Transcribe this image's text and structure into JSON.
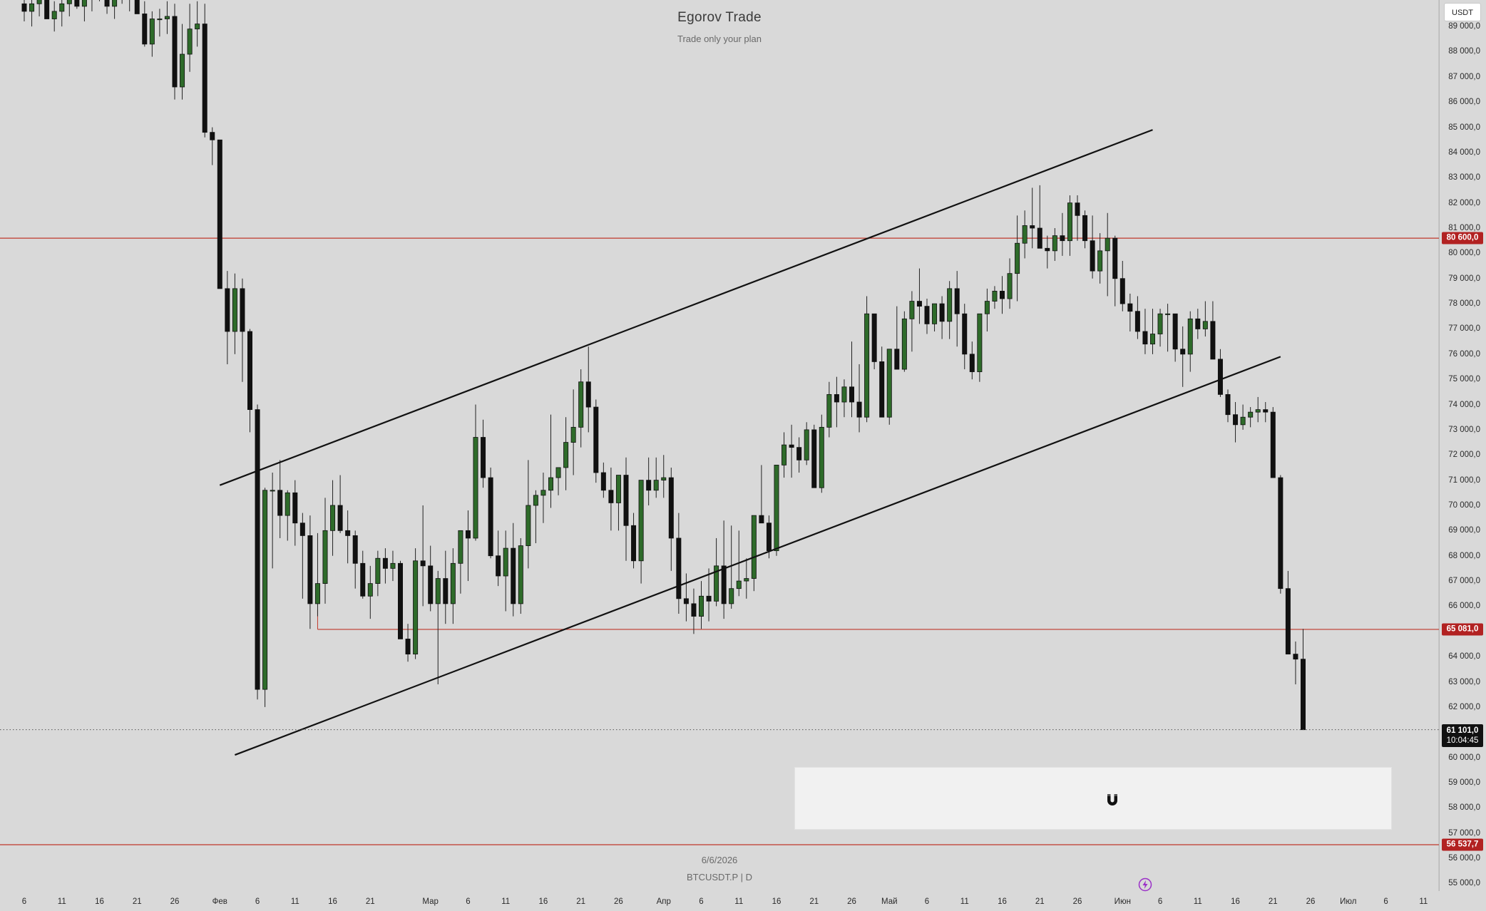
{
  "watermark": {
    "title": "Egorov Trade",
    "subtitle": "Trade only your plan"
  },
  "bottom_info": {
    "date": "6/6/2026",
    "symbol": "BTCUSDT.P | D"
  },
  "currency_button": "USDT",
  "colors": {
    "background": "#d9d9d9",
    "bull": "#2e6b2a",
    "bear": "#111111",
    "level_line": "#c0392b",
    "badge": "#b22222",
    "trendline": "#111111"
  },
  "icons": {
    "magnet": "magnet-icon",
    "replay": "lightning-icon"
  },
  "chart_data": {
    "type": "candlestick",
    "timeframe": "D",
    "ylim": [
      54700,
      90050
    ],
    "y_ticks": [
      55000,
      56000,
      57000,
      58000,
      59000,
      60000,
      61000,
      62000,
      63000,
      64000,
      65000,
      66000,
      67000,
      68000,
      69000,
      70000,
      71000,
      72000,
      73000,
      74000,
      75000,
      76000,
      77000,
      78000,
      79000,
      80000,
      81000,
      82000,
      83000,
      84000,
      85000,
      86000,
      87000,
      88000,
      89000
    ],
    "y_tick_labels": [
      "55 000,0",
      "56 000,0",
      "57 000,0",
      "58 000,0",
      "59 000,0",
      "60 000,0",
      "61 000,0",
      "62 000,0",
      "63 000,0",
      "64 000,0",
      "65 000,0",
      "66 000,0",
      "67 000,0",
      "68 000,0",
      "69 000,0",
      "70 000,0",
      "71 000,0",
      "72 000,0",
      "73 000,0",
      "74 000,0",
      "75 000,0",
      "76 000,0",
      "77 000,0",
      "78 000,0",
      "79 000,0",
      "80 000,0",
      "81 000,0",
      "82 000,0",
      "83 000,0",
      "84 000,0",
      "85 000,0",
      "86 000,0",
      "87 000,0",
      "88 000,0",
      "89 000,0"
    ],
    "x_ticks": [
      {
        "i": 0,
        "label": "6"
      },
      {
        "i": 5,
        "label": "11"
      },
      {
        "i": 10,
        "label": "16"
      },
      {
        "i": 15,
        "label": "21"
      },
      {
        "i": 20,
        "label": "26"
      },
      {
        "i": 26,
        "label": "Фев"
      },
      {
        "i": 31,
        "label": "6"
      },
      {
        "i": 36,
        "label": "11"
      },
      {
        "i": 41,
        "label": "16"
      },
      {
        "i": 46,
        "label": "21"
      },
      {
        "i": 54,
        "label": "Мар"
      },
      {
        "i": 59,
        "label": "6"
      },
      {
        "i": 64,
        "label": "11"
      },
      {
        "i": 69,
        "label": "16"
      },
      {
        "i": 74,
        "label": "21"
      },
      {
        "i": 79,
        "label": "26"
      },
      {
        "i": 85,
        "label": "Апр"
      },
      {
        "i": 90,
        "label": "6"
      },
      {
        "i": 95,
        "label": "11"
      },
      {
        "i": 100,
        "label": "16"
      },
      {
        "i": 105,
        "label": "21"
      },
      {
        "i": 110,
        "label": "26"
      },
      {
        "i": 115,
        "label": "Май"
      },
      {
        "i": 120,
        "label": "6"
      },
      {
        "i": 125,
        "label": "11"
      },
      {
        "i": 130,
        "label": "16"
      },
      {
        "i": 135,
        "label": "21"
      },
      {
        "i": 140,
        "label": "26"
      },
      {
        "i": 146,
        "label": "Июн"
      },
      {
        "i": 151,
        "label": "6"
      },
      {
        "i": 156,
        "label": "11"
      },
      {
        "i": 161,
        "label": "16"
      },
      {
        "i": 166,
        "label": "21"
      },
      {
        "i": 171,
        "label": "26"
      },
      {
        "i": 176,
        "label": "Июл"
      },
      {
        "i": 181,
        "label": "6"
      },
      {
        "i": 186,
        "label": "11"
      }
    ],
    "levels": [
      {
        "price": 80600,
        "label": "80 600,0"
      },
      {
        "price": 65081,
        "label": "65 081,0",
        "from_index": 39
      },
      {
        "price": 56537.7,
        "label": "56 537,7"
      }
    ],
    "last_price": {
      "price": 61101,
      "label": "61 101,0",
      "countdown": "10:04:45"
    },
    "channel_lines": [
      {
        "from": [
          26,
          70800
        ],
        "to": [
          150,
          84900
        ]
      },
      {
        "from": [
          28,
          60100
        ],
        "to": [
          167,
          75900
        ]
      }
    ],
    "candles": [
      [
        0,
        89900,
        91000,
        89200,
        89600
      ],
      [
        1,
        89600,
        90300,
        89000,
        89900
      ],
      [
        2,
        89900,
        90500,
        89400,
        90100
      ],
      [
        3,
        90100,
        91000,
        89600,
        89300
      ],
      [
        4,
        89300,
        90000,
        88800,
        89600
      ],
      [
        5,
        89600,
        90400,
        89000,
        89900
      ],
      [
        6,
        89900,
        90700,
        89400,
        90300
      ],
      [
        7,
        90300,
        91200,
        89700,
        89800
      ],
      [
        8,
        89800,
        90600,
        89200,
        90100
      ],
      [
        9,
        90100,
        91000,
        89600,
        90700
      ],
      [
        10,
        90700,
        91300,
        90000,
        90200
      ],
      [
        11,
        90200,
        90800,
        89500,
        89800
      ],
      [
        12,
        89800,
        90600,
        89300,
        90400
      ],
      [
        13,
        90400,
        91200,
        89900,
        90200
      ],
      [
        14,
        90200,
        90900,
        89600,
        90500
      ],
      [
        15,
        90500,
        91000,
        89500,
        89500
      ],
      [
        16,
        89500,
        90000,
        88200,
        88300
      ],
      [
        17,
        88300,
        89600,
        87800,
        89300
      ],
      [
        18,
        89300,
        89700,
        88600,
        89300
      ],
      [
        19,
        89300,
        90000,
        88700,
        89400
      ],
      [
        20,
        89400,
        89900,
        86100,
        86600
      ],
      [
        21,
        86600,
        89100,
        86100,
        87900
      ],
      [
        22,
        87900,
        89900,
        87200,
        88900
      ],
      [
        23,
        88900,
        90000,
        88200,
        89100
      ],
      [
        24,
        89100,
        89900,
        84600,
        84800
      ],
      [
        25,
        84800,
        85000,
        83500,
        84500
      ],
      [
        26,
        84500,
        84500,
        80300,
        78600
      ],
      [
        27,
        78600,
        79300,
        75600,
        76900
      ],
      [
        28,
        76900,
        79200,
        76000,
        78600
      ],
      [
        29,
        78600,
        79000,
        74900,
        76900
      ],
      [
        30,
        76900,
        77000,
        72900,
        73800
      ],
      [
        31,
        73800,
        74000,
        62300,
        62700
      ],
      [
        32,
        62700,
        70700,
        62000,
        70600
      ],
      [
        33,
        70600,
        71300,
        67500,
        70600
      ],
      [
        34,
        70600,
        71800,
        68700,
        69600
      ],
      [
        35,
        69600,
        70600,
        68600,
        70500
      ],
      [
        36,
        70500,
        71000,
        68400,
        69300
      ],
      [
        37,
        69300,
        69700,
        66300,
        68800
      ],
      [
        38,
        68800,
        69600,
        65100,
        66100
      ],
      [
        39,
        66100,
        68900,
        65600,
        66900
      ],
      [
        40,
        66900,
        70300,
        66100,
        69000
      ],
      [
        41,
        69000,
        71000,
        68000,
        70000
      ],
      [
        42,
        70000,
        71200,
        68900,
        69000
      ],
      [
        43,
        69000,
        69800,
        67700,
        68800
      ],
      [
        44,
        68800,
        69000,
        66700,
        67700
      ],
      [
        45,
        67700,
        68200,
        66300,
        66400
      ],
      [
        46,
        66400,
        67600,
        65500,
        66900
      ],
      [
        47,
        66900,
        68200,
        66400,
        67900
      ],
      [
        48,
        67900,
        68300,
        66900,
        67500
      ],
      [
        49,
        67500,
        68200,
        67000,
        67700
      ],
      [
        50,
        67700,
        67800,
        65000,
        64700
      ],
      [
        51,
        64700,
        65300,
        63800,
        64100
      ],
      [
        52,
        64100,
        68300,
        63900,
        67800
      ],
      [
        53,
        67800,
        70000,
        66000,
        67600
      ],
      [
        54,
        67600,
        68400,
        65800,
        66100
      ],
      [
        55,
        66100,
        67400,
        62900,
        67100
      ],
      [
        56,
        67100,
        68200,
        65300,
        66100
      ],
      [
        57,
        66100,
        68300,
        65300,
        67700
      ],
      [
        58,
        67700,
        68800,
        66500,
        69000
      ],
      [
        59,
        69000,
        69800,
        67000,
        68700
      ],
      [
        60,
        68700,
        74000,
        68600,
        72700
      ],
      [
        61,
        72700,
        73400,
        70700,
        71100
      ],
      [
        62,
        71100,
        71500,
        67900,
        68000
      ],
      [
        63,
        68000,
        69000,
        66800,
        67200
      ],
      [
        64,
        67200,
        69000,
        65800,
        68300
      ],
      [
        65,
        68300,
        69300,
        65600,
        66100
      ],
      [
        66,
        66100,
        68700,
        65700,
        68400
      ],
      [
        67,
        68400,
        71800,
        67500,
        70000
      ],
      [
        68,
        70000,
        70600,
        68500,
        70400
      ],
      [
        69,
        70400,
        71300,
        69300,
        70600
      ],
      [
        70,
        70600,
        73600,
        69900,
        71100
      ],
      [
        71,
        71100,
        71500,
        70400,
        71500
      ],
      [
        72,
        71500,
        73500,
        70600,
        72500
      ],
      [
        73,
        72500,
        74600,
        71200,
        73100
      ],
      [
        74,
        73100,
        75400,
        72300,
        74900
      ],
      [
        75,
        74900,
        76300,
        72900,
        73900
      ],
      [
        76,
        73900,
        74200,
        70900,
        71300
      ],
      [
        77,
        71300,
        71700,
        70300,
        70600
      ],
      [
        78,
        70600,
        71500,
        69000,
        70100
      ],
      [
        79,
        70100,
        71200,
        69000,
        71200
      ],
      [
        80,
        71200,
        71900,
        67800,
        69200
      ],
      [
        81,
        69200,
        69700,
        67500,
        67800
      ],
      [
        82,
        67800,
        69000,
        66900,
        71000
      ],
      [
        83,
        71000,
        71900,
        70000,
        70600
      ],
      [
        84,
        70600,
        71900,
        70300,
        71000
      ],
      [
        85,
        71000,
        72000,
        70300,
        71100
      ],
      [
        86,
        71100,
        71500,
        67400,
        68700
      ],
      [
        87,
        68700,
        69700,
        65700,
        66300
      ],
      [
        88,
        66300,
        67300,
        65400,
        66100
      ],
      [
        89,
        66100,
        66700,
        64900,
        65600
      ],
      [
        90,
        65600,
        67000,
        65100,
        66400
      ],
      [
        91,
        66400,
        67500,
        65400,
        66200
      ],
      [
        92,
        66200,
        68700,
        66000,
        67600
      ],
      [
        93,
        67600,
        69400,
        65500,
        66100
      ],
      [
        94,
        66100,
        69200,
        65900,
        66700
      ],
      [
        95,
        66700,
        69000,
        66400,
        67000
      ],
      [
        96,
        67000,
        67900,
        66300,
        67100
      ],
      [
        97,
        67100,
        68700,
        66600,
        69600
      ],
      [
        98,
        69600,
        71600,
        69300,
        69300
      ],
      [
        99,
        69300,
        69600,
        67900,
        68200
      ],
      [
        100,
        68200,
        71200,
        68000,
        71600
      ],
      [
        101,
        71600,
        72900,
        71100,
        72400
      ],
      [
        102,
        72400,
        73200,
        71100,
        72300
      ],
      [
        103,
        72300,
        72700,
        71300,
        71800
      ],
      [
        104,
        71800,
        73300,
        71600,
        73000
      ],
      [
        105,
        73000,
        73200,
        70700,
        70700
      ],
      [
        106,
        70700,
        73600,
        70500,
        73100
      ],
      [
        107,
        73100,
        74900,
        72700,
        74400
      ],
      [
        108,
        74400,
        75100,
        73100,
        74100
      ],
      [
        109,
        74100,
        75000,
        73500,
        74700
      ],
      [
        110,
        74700,
        76500,
        73500,
        74100
      ],
      [
        111,
        74100,
        75600,
        72900,
        73500
      ],
      [
        112,
        73500,
        78300,
        73300,
        77600
      ],
      [
        113,
        77600,
        77300,
        75400,
        75700
      ],
      [
        114,
        75700,
        76300,
        73800,
        73500
      ],
      [
        115,
        73500,
        75700,
        73200,
        76200
      ],
      [
        116,
        76200,
        77900,
        75600,
        75400
      ],
      [
        117,
        75400,
        77700,
        75300,
        77400
      ],
      [
        118,
        77400,
        78500,
        76100,
        78100
      ],
      [
        119,
        78100,
        79400,
        77200,
        77900
      ],
      [
        120,
        77900,
        78200,
        76800,
        77200
      ],
      [
        121,
        77200,
        77900,
        76900,
        78000
      ],
      [
        122,
        78000,
        78300,
        76600,
        77300
      ],
      [
        123,
        77300,
        78900,
        76600,
        78600
      ],
      [
        124,
        78600,
        79300,
        76300,
        77600
      ],
      [
        125,
        77600,
        78000,
        75400,
        76000
      ],
      [
        126,
        76000,
        76500,
        75000,
        75300
      ],
      [
        127,
        75300,
        76900,
        74900,
        77600
      ],
      [
        128,
        77600,
        78600,
        76900,
        78100
      ],
      [
        129,
        78100,
        78700,
        77800,
        78500
      ],
      [
        130,
        78500,
        79100,
        77600,
        78200
      ],
      [
        131,
        78200,
        79800,
        77800,
        79200
      ],
      [
        132,
        79200,
        81500,
        78100,
        80400
      ],
      [
        133,
        80400,
        81700,
        79800,
        81100
      ],
      [
        134,
        81100,
        82600,
        80200,
        81000
      ],
      [
        135,
        81000,
        82700,
        80400,
        80200
      ],
      [
        136,
        80200,
        80700,
        79400,
        80100
      ],
      [
        137,
        80100,
        81000,
        79700,
        80700
      ],
      [
        138,
        80700,
        81600,
        79900,
        80500
      ],
      [
        139,
        80500,
        82300,
        79900,
        82000
      ],
      [
        140,
        82000,
        82300,
        80500,
        81500
      ],
      [
        141,
        81500,
        81700,
        80200,
        80500
      ],
      [
        142,
        80500,
        81500,
        79000,
        79300
      ],
      [
        143,
        79300,
        80800,
        78800,
        80100
      ],
      [
        144,
        80100,
        81600,
        78300,
        80600
      ],
      [
        145,
        80600,
        80700,
        77900,
        79000
      ],
      [
        146,
        79000,
        79700,
        77700,
        78000
      ],
      [
        147,
        78000,
        78400,
        76900,
        77700
      ],
      [
        148,
        77700,
        78300,
        76600,
        76900
      ],
      [
        149,
        76900,
        77800,
        76000,
        76400
      ],
      [
        150,
        76400,
        77800,
        76000,
        76800
      ],
      [
        151,
        76800,
        77800,
        76300,
        77600
      ],
      [
        152,
        77600,
        78000,
        76100,
        77600
      ],
      [
        153,
        77600,
        77600,
        75700,
        76200
      ],
      [
        154,
        76200,
        77100,
        74700,
        76000
      ],
      [
        155,
        76000,
        77700,
        75300,
        77400
      ],
      [
        156,
        77400,
        77800,
        76600,
        77000
      ],
      [
        157,
        77000,
        78100,
        76700,
        77300
      ],
      [
        158,
        77300,
        78100,
        76000,
        75800
      ],
      [
        159,
        75800,
        76200,
        74300,
        74400
      ],
      [
        160,
        74400,
        74600,
        73300,
        73600
      ],
      [
        161,
        73600,
        74100,
        72500,
        73200
      ],
      [
        162,
        73200,
        74000,
        73000,
        73500
      ],
      [
        163,
        73500,
        73900,
        73100,
        73700
      ],
      [
        164,
        73700,
        74300,
        73300,
        73800
      ],
      [
        165,
        73800,
        74100,
        73300,
        73700
      ],
      [
        166,
        73700,
        73900,
        71300,
        71100
      ],
      [
        167,
        71100,
        71200,
        66500,
        66700
      ],
      [
        168,
        66700,
        67400,
        65400,
        64100
      ],
      [
        169,
        64100,
        64600,
        62900,
        63900
      ],
      [
        170,
        63900,
        65100,
        61300,
        61100
      ]
    ]
  }
}
